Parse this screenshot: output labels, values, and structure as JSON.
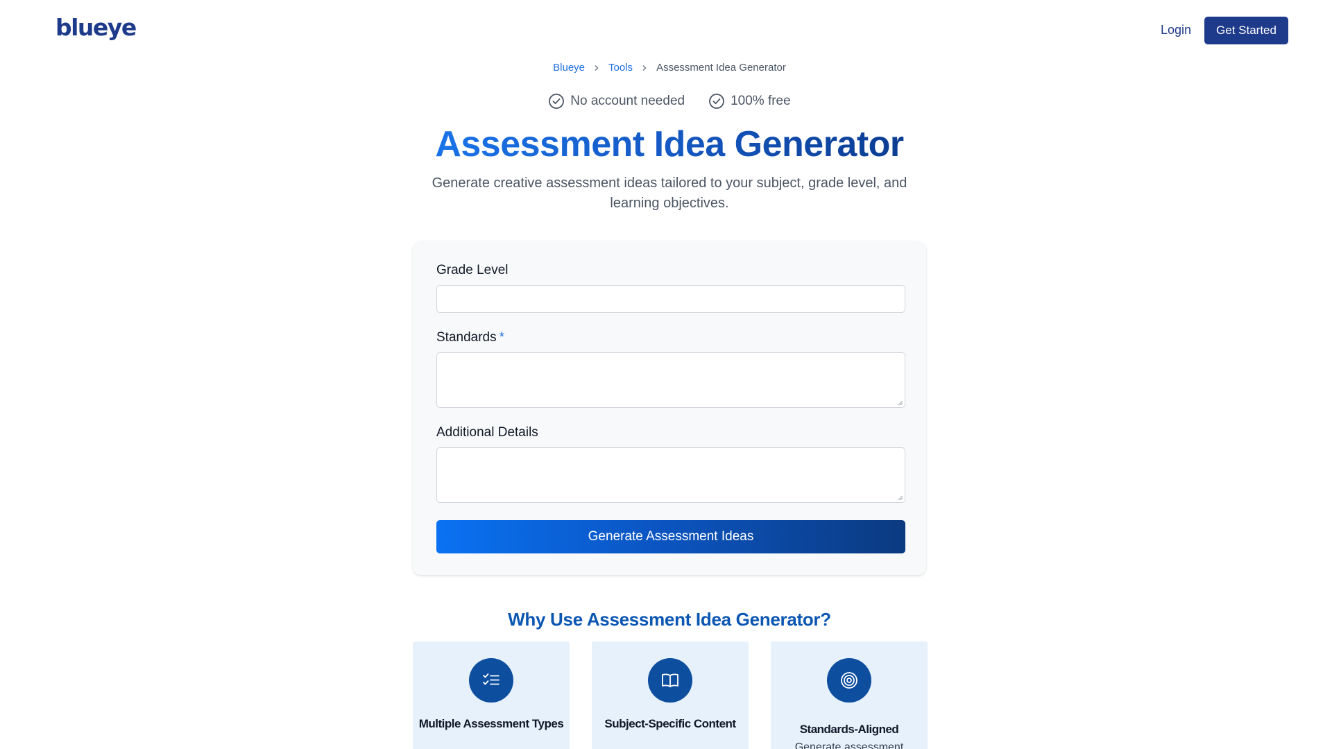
{
  "header": {
    "logo": "blueye",
    "login_label": "Login",
    "get_started_label": "Get Started"
  },
  "breadcrumb": {
    "items": [
      "Blueye",
      "Tools",
      "Assessment Idea Generator"
    ]
  },
  "badges": [
    "No account needed",
    "100% free"
  ],
  "hero": {
    "title": "Assessment Idea Generator",
    "subtitle": "Generate creative assessment ideas tailored to your subject, grade level, and learning objectives."
  },
  "form": {
    "grade_level_label": "Grade Level",
    "grade_level_value": "",
    "standards_label": "Standards",
    "standards_required_mark": "*",
    "standards_value": "",
    "additional_label": "Additional Details",
    "additional_value": "",
    "submit_label": "Generate Assessment Ideas"
  },
  "why": {
    "title": "Why Use Assessment Idea Generator?",
    "features": [
      {
        "icon": "checklist-icon",
        "title": "Multiple Assessment Types",
        "desc": ""
      },
      {
        "icon": "open-book-icon",
        "title": "Subject-Specific Content",
        "desc": ""
      },
      {
        "icon": "target-icon",
        "title": "Standards-Aligned",
        "desc": "Generate assessment"
      }
    ]
  },
  "colors": {
    "brand_navy": "#1e3a8a",
    "link_blue": "#1d6fe0",
    "heading_blue": "#0b56b3",
    "icon_circle": "#0d4e9f",
    "feature_bg": "#e6f1fc",
    "form_bg": "#f8f9fa"
  }
}
